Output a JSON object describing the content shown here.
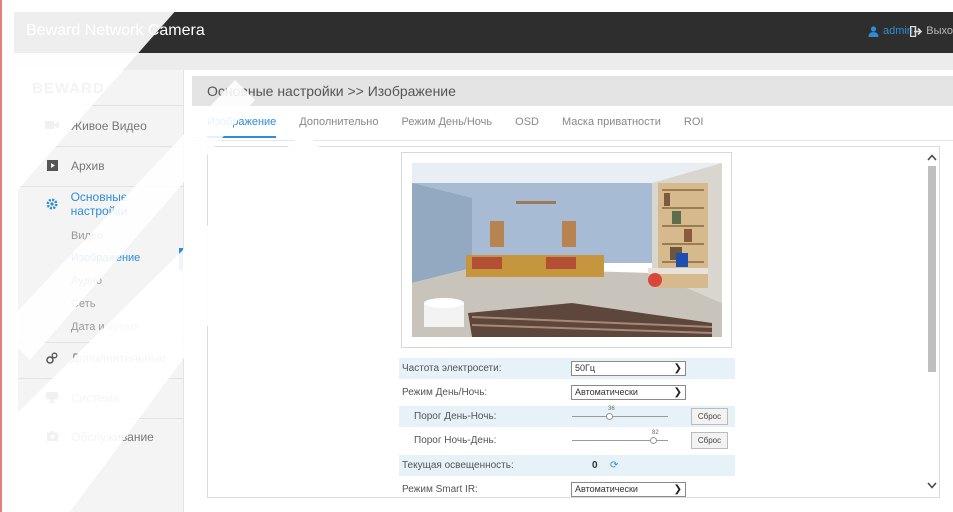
{
  "app": {
    "title": "Beward Network Camera"
  },
  "header": {
    "user": "admin",
    "logout": "Выхо"
  },
  "sidebar": {
    "logo": "BEWARD",
    "items": [
      {
        "label": "Живое Видео",
        "icon": "video-camera-icon"
      },
      {
        "label": "Архив",
        "icon": "archive-icon"
      },
      {
        "label": "Основные настройки",
        "icon": "gear-icon"
      },
      {
        "label": "Дополнительные",
        "icon": "advanced-settings-icon"
      },
      {
        "label": "Система",
        "icon": "monitor-icon"
      },
      {
        "label": "Обслуживание",
        "icon": "maintenance-icon"
      }
    ],
    "subitems": [
      "Видео",
      "Изображение",
      "Аудио",
      "Сеть",
      "Дата и время"
    ]
  },
  "breadcrumb": "Основные настройки >> Изображение",
  "tabs": [
    "Изображение",
    "Дополнительно",
    "Режим День/Ночь",
    "OSD",
    "Маска приватности",
    "ROI"
  ],
  "settings": {
    "power_freq": {
      "label": "Частота электросети:",
      "value": "50Гц"
    },
    "day_night_mode": {
      "label": "Режим День/Ночь:",
      "value": "Автоматически"
    },
    "day_night_threshold": {
      "label": "Порог День-Ночь:",
      "value": "36",
      "reset": "Сброс"
    },
    "night_day_threshold": {
      "label": "Порог Ночь-День:",
      "value": "82",
      "reset": "Сброс"
    },
    "current_illumination": {
      "label": "Текущая освещенность:",
      "value": "0"
    },
    "smart_ir": {
      "label": "Режим Smart IR:",
      "value": "Автоматически"
    }
  },
  "colors": {
    "accent": "#2f8cd6",
    "topbar": "#2e2e2e",
    "row_highlight": "#e6f1f8"
  }
}
